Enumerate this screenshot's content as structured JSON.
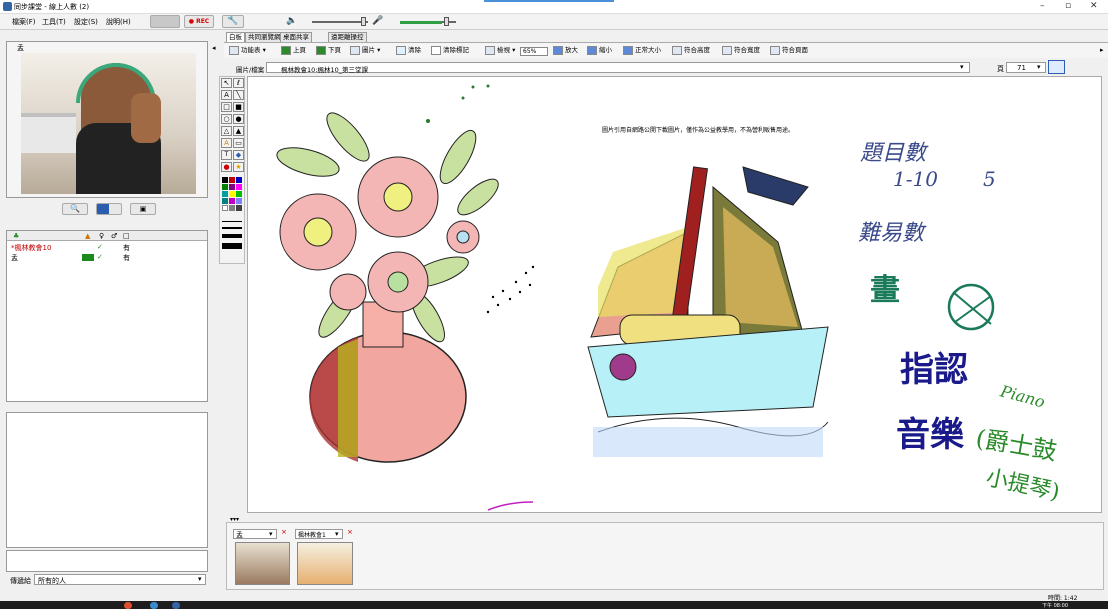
{
  "window": {
    "title": "同步課堂 - 線上人數 (2)",
    "controls": [
      "–",
      "▫",
      "✕"
    ]
  },
  "menu": [
    "檔案(F)",
    "工具(T)",
    "設定(S)",
    "說明(H)"
  ],
  "toolbar": {
    "rec_label": "● REC"
  },
  "left": {
    "video_name": "孟",
    "users_header": [
      "♣",
      "▲",
      "♀",
      "♂",
      "□"
    ],
    "users": [
      {
        "name": "*楓林教會10",
        "check": "✓",
        "status": "有",
        "color": "#c00000"
      },
      {
        "name": "孟",
        "check": "✓",
        "status": "有",
        "color": "#000"
      }
    ],
    "send_label": "傳遞給",
    "send_value": "所有的人"
  },
  "tabs": [
    "白板",
    "共同瀏覽網頁",
    "桌面共享",
    "遠距離操控"
  ],
  "wb_toolbar": [
    "功能表 ▾",
    "上頁",
    "下頁",
    "圖片 ▾",
    "清除",
    "清除標記",
    "檢視 ▾",
    "65%",
    "放大",
    "縮小",
    "正常大小",
    "符合高度",
    "符合寬度",
    "符合頁面"
  ],
  "file": {
    "label": "圖片/檔案",
    "value": "楓林教會10:楓林10_第三堂課",
    "page_label": "頁",
    "page_value": "71"
  },
  "canvas": {
    "notice": "圖片引用自網路公開下載圖片，僅作為公益教學用，不為營利販售用途。",
    "handwriting": [
      "題目數",
      "1-10",
      "5",
      "難易數",
      "畫",
      "指認",
      "音樂",
      "Piano",
      "(爵士鼓",
      "小提琴)"
    ]
  },
  "bottom": {
    "user1": "孟",
    "user2": "楓林教會1"
  },
  "status": {
    "time": "時間: 1:42",
    "clock": "下午 08:00"
  }
}
